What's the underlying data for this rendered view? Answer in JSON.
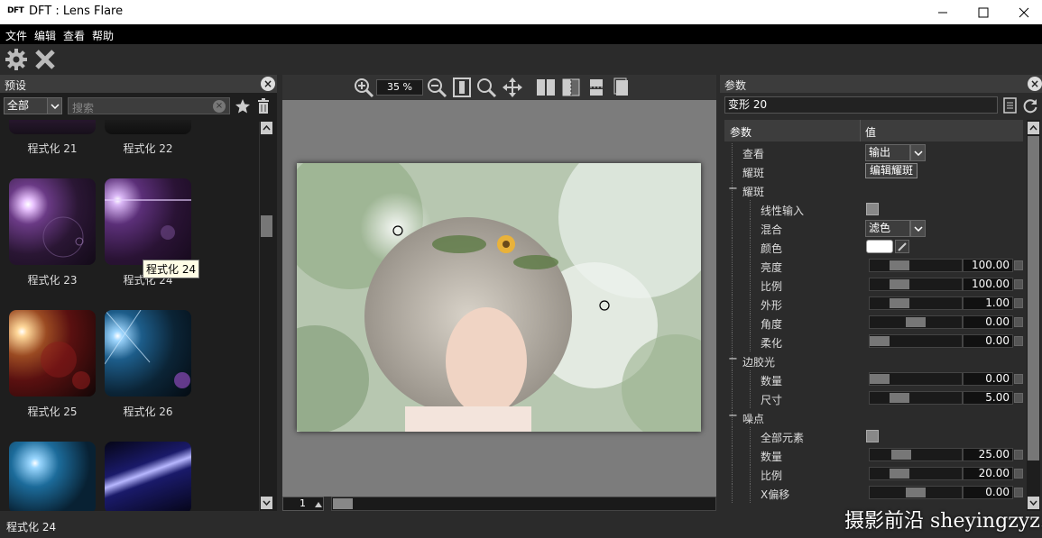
{
  "window": {
    "logo": "DFT",
    "title": "DFT : Lens Flare"
  },
  "menu": [
    "文件",
    "编辑",
    "查看",
    "帮助"
  ],
  "presets": {
    "header": "预设",
    "filter_selected": "全部",
    "search_placeholder": "搜索",
    "thumbs": [
      {
        "label": "程式化 21"
      },
      {
        "label": "程式化 22"
      },
      {
        "label": "程式化 23"
      },
      {
        "label": "程式化 24"
      },
      {
        "label": "程式化 25"
      },
      {
        "label": "程式化 26"
      }
    ],
    "tooltip": "程式化 24"
  },
  "viewer": {
    "zoom": "35 %",
    "page": "1"
  },
  "params": {
    "header": "参数",
    "preset_name": "变形 20",
    "col_param": "参数",
    "col_value": "值",
    "rows": [
      {
        "label": "查看",
        "type": "dropdown",
        "value": "输出"
      },
      {
        "label": "耀斑",
        "type": "button",
        "value": "编辑耀斑"
      },
      {
        "label": "耀斑",
        "type": "group"
      },
      {
        "label": "线性输入",
        "type": "checkbox"
      },
      {
        "label": "混合",
        "type": "dropdown",
        "value": "滤色"
      },
      {
        "label": "颜色",
        "type": "color",
        "value": "#ffffff"
      },
      {
        "label": "亮度",
        "type": "slider",
        "value": "100.00",
        "level": 0.27
      },
      {
        "label": "比例",
        "type": "slider",
        "value": "100.00",
        "level": 0.27
      },
      {
        "label": "外形",
        "type": "slider",
        "value": "1.00",
        "level": 0.27
      },
      {
        "label": "角度",
        "type": "slider",
        "value": "0.00",
        "level": 0.5
      },
      {
        "label": "柔化",
        "type": "slider",
        "value": "0.00",
        "level": 0.0
      },
      {
        "label": "边胶光",
        "type": "group"
      },
      {
        "label": "数量",
        "type": "slider",
        "value": "0.00",
        "level": 0.0
      },
      {
        "label": "尺寸",
        "type": "slider",
        "value": "5.00",
        "level": 0.27
      },
      {
        "label": "噪点",
        "type": "group"
      },
      {
        "label": "全部元素",
        "type": "checkbox"
      },
      {
        "label": "数量",
        "type": "slider",
        "value": "25.00",
        "level": 0.3
      },
      {
        "label": "比例",
        "type": "slider",
        "value": "20.00",
        "level": 0.27
      },
      {
        "label": "X偏移",
        "type": "slider",
        "value": "0.00",
        "level": 0.5
      }
    ]
  },
  "status": {
    "text": "程式化 24"
  },
  "watermark": "摄影前沿 sheyingzyz.com",
  "colors": {
    "panel_bg": "#2b2b2b",
    "canvas_bg": "#7c7c7c",
    "menubar_bg": "#000000"
  }
}
